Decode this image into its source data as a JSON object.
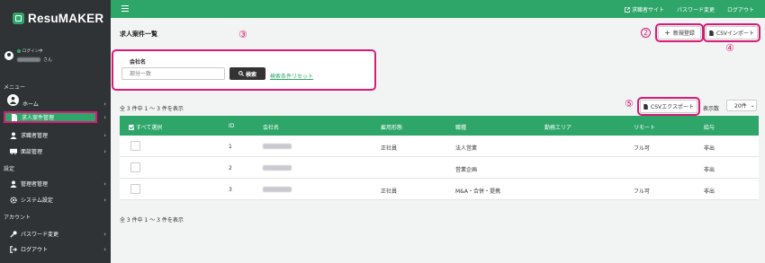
{
  "sidebar": {
    "logo": "ResuMAKER",
    "user_status": "ログイン中",
    "user_suffix": "さん",
    "sections": {
      "menu": "メニュー",
      "settings": "設定",
      "account": "アカウント"
    },
    "items": {
      "home": "ホーム",
      "jobs": "求人案件管理",
      "seekers": "求職者管理",
      "interviews": "面談管理",
      "admins": "管理者管理",
      "system": "システム設定",
      "password": "パスワード変更",
      "logout": "ログアウト"
    }
  },
  "header": {
    "links": {
      "seeker_site": "求職者サイト",
      "change_password": "パスワード変更",
      "logout": "ログアウト"
    }
  },
  "main": {
    "title": "求人案件一覧",
    "new_button": "新規登録",
    "csv_import": "CSVインポート",
    "csv_export": "CSVエクスポート",
    "annotations": {
      "a2": "2",
      "a3": "③",
      "a4": "④",
      "a5": "⑤"
    },
    "search": {
      "label": "会社名",
      "placeholder": "部分一致",
      "button": "検索",
      "reset": "検索条件リセット"
    },
    "count_top": "全 3 件中 1 〜 3 件を表示",
    "count_bottom": "全 3 件中 1 〜 3 件を表示",
    "per_page_label": "表示数",
    "per_page_value": "20件"
  },
  "table": {
    "headers": {
      "select_all": "すべて選択",
      "id": "ID",
      "company": "会社名",
      "employment": "雇用形態",
      "job": "職種",
      "area": "勤務エリア",
      "remote": "リモート",
      "salary": "給与"
    },
    "rows": [
      {
        "id": "1",
        "employment": "正社員",
        "job": "法人営業",
        "area": "",
        "remote": "フル可",
        "salary": "非出"
      },
      {
        "id": "2",
        "employment": "",
        "job": "営業企画",
        "area": "",
        "remote": "",
        "salary": "非出"
      },
      {
        "id": "3",
        "employment": "正社員",
        "job": "M&A・合併・提携",
        "area": "",
        "remote": "フル可",
        "salary": "非出"
      }
    ]
  },
  "colors": {
    "brand_green": "#2ea66a",
    "sidebar_bg": "#2f3336",
    "highlight": "#d81b78"
  }
}
